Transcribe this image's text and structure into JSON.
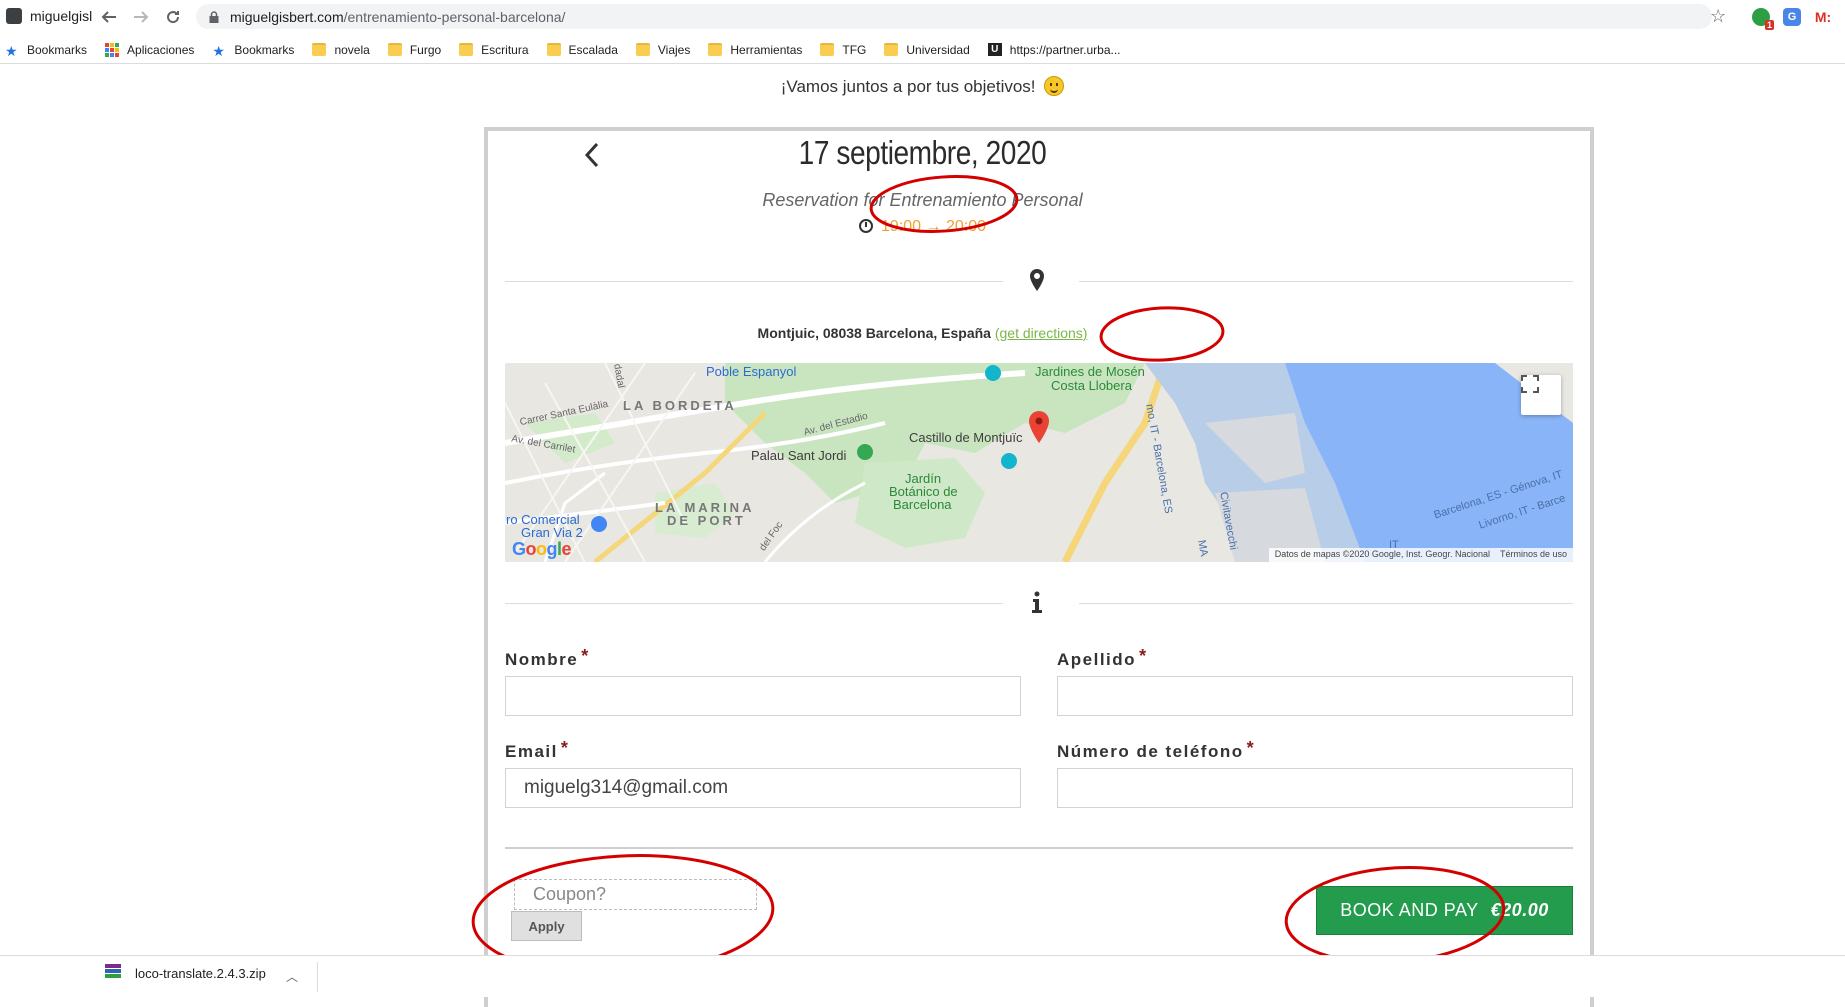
{
  "browser": {
    "tab_title": "miguelgisl",
    "url_host": "miguelgisbert.com",
    "url_path": "/entrenamiento-personal-barcelona/",
    "bookmarks": [
      {
        "label": "Bookmarks",
        "icon": "star-icon"
      },
      {
        "label": "Aplicaciones",
        "icon": "apps-grid-icon"
      },
      {
        "label": "Bookmarks",
        "icon": "star-icon"
      },
      {
        "label": "novela",
        "icon": "folder-icon"
      },
      {
        "label": "Furgo",
        "icon": "folder-icon"
      },
      {
        "label": "Escritura",
        "icon": "folder-icon"
      },
      {
        "label": "Escalada",
        "icon": "folder-icon"
      },
      {
        "label": "Viajes",
        "icon": "folder-icon"
      },
      {
        "label": "Herramientas",
        "icon": "folder-icon"
      },
      {
        "label": "TFG",
        "icon": "folder-icon"
      },
      {
        "label": "Universidad",
        "icon": "folder-icon"
      },
      {
        "label": "https://partner.urba...",
        "icon": "u-site-icon"
      }
    ],
    "extensions": [
      {
        "name": "extension-green",
        "badge": "1",
        "color": "#2e9e44"
      },
      {
        "name": "translate-extension",
        "color": "#4a86e8"
      },
      {
        "name": "gmail-extension",
        "label": "M",
        "color": "#d93025"
      }
    ]
  },
  "page": {
    "tagline": "¡Vamos juntos a por tus objetivos!",
    "booking": {
      "date": "17 septiembre, 2020",
      "reservation_for": "Reservation for Entrenamiento Personal",
      "time": "19:00 → 20:00",
      "address": "Montjuic, 08038 Barcelona, España",
      "get_directions": "(get directions)"
    },
    "map": {
      "labels": {
        "poble_espanyol": "Poble Espanyol",
        "jardines_1": "Jardines de Mosén",
        "jardines_2": "Costa Llobera",
        "la_bordeta": "LA BORDETA",
        "carrer_santa_eulalia": "Carrer Santa Eulàlia",
        "av_estadio": "Av. del Estadio",
        "av_carrilet": "Av. del Carrilet",
        "castillo": "Castillo de Montjuïc",
        "palau": "Palau Sant Jordi",
        "jardin_1": "Jardín",
        "jardin_2": "Botánico de",
        "jardin_3": "Barcelona",
        "la_marina_1": "LA MARINA",
        "la_marina_2": "DE PORT",
        "centro_1": "ro Comercial",
        "centro_2": "Gran Via 2",
        "del_foc": "del Foc",
        "ronda_litoral": "mo, IT - Barcelona, ES",
        "route_genova": "Barcelona, ES - Génova, IT",
        "route_livorno": "Livorno, IT - Barce",
        "civitavecchia": "Civitavecchi",
        "ma": "MA",
        "dadal": "dadal",
        "it": "IT"
      },
      "google": "Google",
      "attribution": "Datos de mapas ©2020 Google, Inst. Geogr. Nacional",
      "terms": "Términos de uso"
    },
    "form": {
      "nombre_label": "Nombre",
      "apellido_label": "Apellido",
      "email_label": "Email",
      "telefono_label": "Número de teléfono",
      "required_mark": "*",
      "nombre_value": "",
      "apellido_value": "",
      "email_value": "miguelg314@gmail.com",
      "telefono_value": ""
    },
    "coupon": {
      "placeholder": "Coupon?",
      "apply_label": "Apply"
    },
    "book_button": {
      "label": "BOOK AND PAY",
      "price": "€20.00"
    }
  },
  "downloads": {
    "file_name": "loco-translate.2.4.3.zip"
  },
  "colors": {
    "accent_green": "#239c4d",
    "time_orange": "#f0a030",
    "link_green": "#7ab648",
    "annotation_red": "#d40000"
  }
}
